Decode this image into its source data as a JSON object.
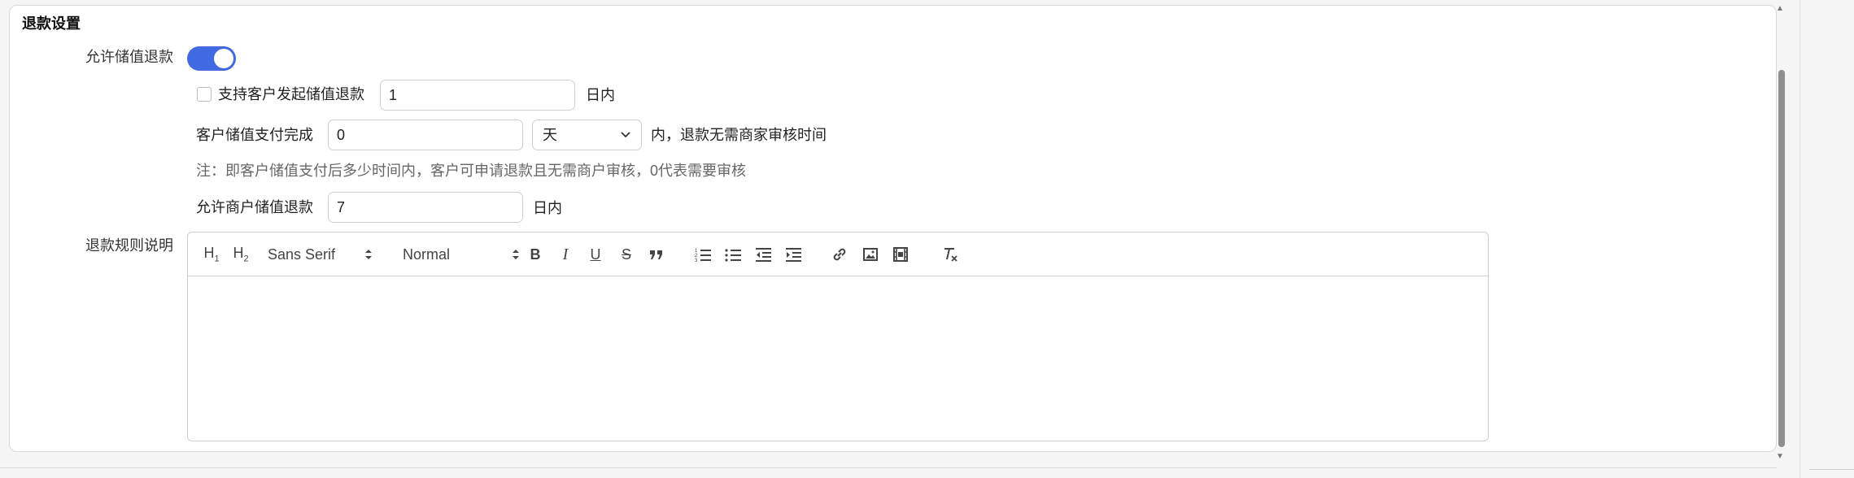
{
  "section": {
    "title": "退款设置"
  },
  "allow_refund": {
    "label": "允许储值退款",
    "enabled": true
  },
  "customer_refund": {
    "checkbox_label": "支持客户发起储值退款",
    "days_value": "1",
    "suffix": "日内"
  },
  "auto_refund": {
    "prefix": "客户储值支付完成",
    "value": "0",
    "unit_selected": "天",
    "suffix": "内，退款无需商家审核时间",
    "note": "注：即客户储值支付后多少时间内，客户可申请退款且无需商户审核，0代表需要审核"
  },
  "merchant_refund": {
    "label": "允许商户储值退款",
    "days_value": "7",
    "suffix": "日内"
  },
  "rules": {
    "label": "退款规则说明",
    "toolbar": {
      "h1": "H1",
      "h2": "H2",
      "font_select": "Sans Serif",
      "size_select": "Normal"
    }
  },
  "colors": {
    "accent": "#4169e1"
  }
}
